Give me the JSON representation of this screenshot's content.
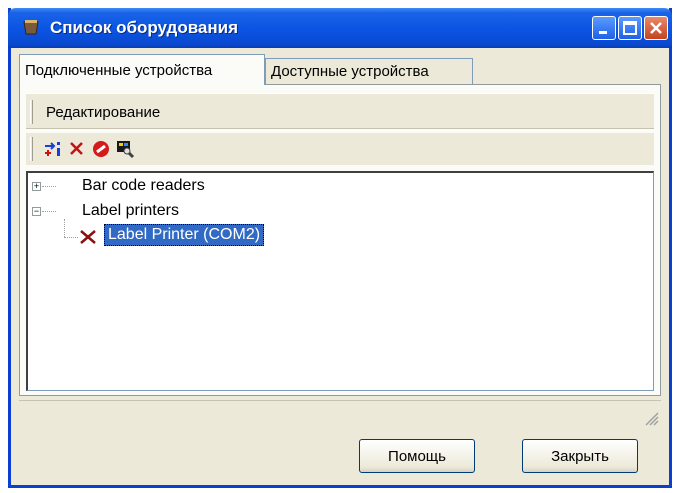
{
  "window": {
    "title": "Список оборудования",
    "controls": {
      "minimize": "minimize-icon",
      "maximize": "maximize-icon",
      "close": "close-icon"
    }
  },
  "tabs": [
    {
      "label": "Подключенные устройства",
      "active": true
    },
    {
      "label": "Доступные устройства",
      "active": false
    }
  ],
  "menu": {
    "items": [
      "Редактирование"
    ]
  },
  "toolbar": {
    "tools": [
      {
        "icon": "add-device-icon"
      },
      {
        "icon": "delete-icon"
      },
      {
        "icon": "disable-icon"
      },
      {
        "icon": "properties-icon"
      }
    ]
  },
  "tree": {
    "nodes": [
      {
        "label": "Bar code readers",
        "expanded": false,
        "children": []
      },
      {
        "label": "Label printers",
        "expanded": true,
        "children": [
          {
            "label": "Label Printer (COM2)",
            "selected": true,
            "icon": "device-disconnected-icon"
          }
        ]
      }
    ]
  },
  "buttons": {
    "help": "Помощь",
    "close": "Закрыть"
  },
  "colors": {
    "title_bar": "#0b55e3",
    "selection": "#316ac5",
    "face": "#ece9d8"
  }
}
